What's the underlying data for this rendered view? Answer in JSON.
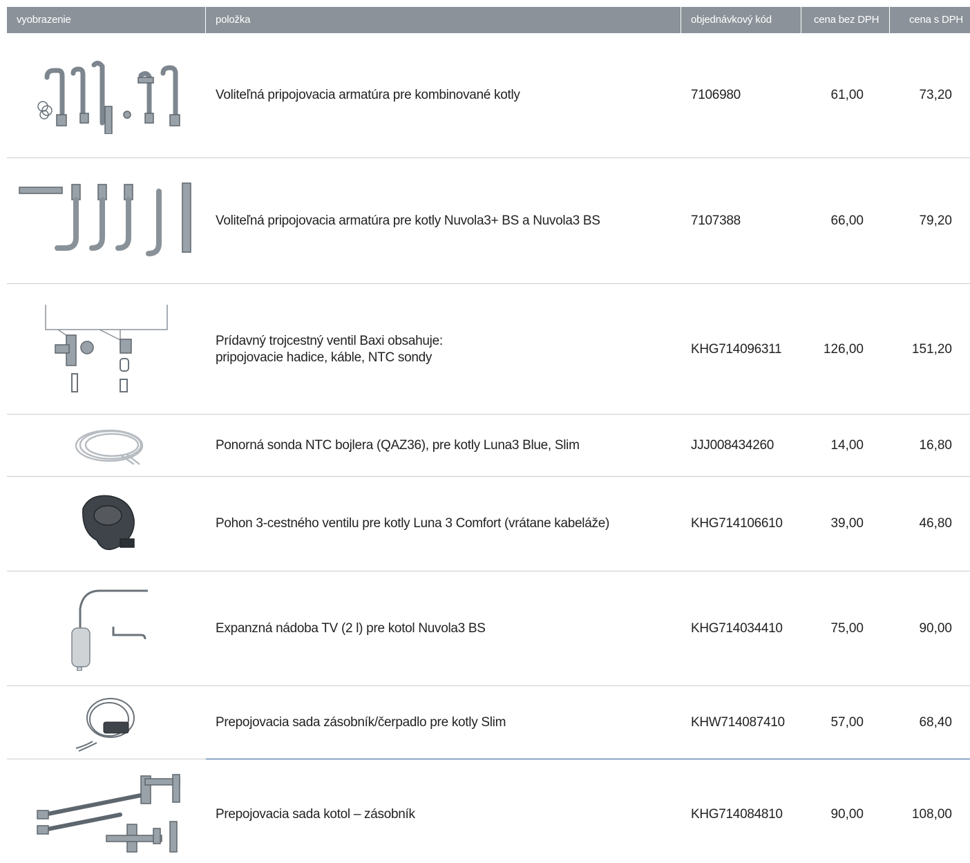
{
  "header": {
    "image": "vyobrazenie",
    "item": "položka",
    "code": "objednávkový kód",
    "price_net": "cena bez DPH",
    "price_gross": "cena s DPH"
  },
  "rows": [
    {
      "item": "Voliteľná pripojovacia armatúra pre kombinované kotly",
      "item2": "",
      "code": "7106980",
      "price_net": "61,00",
      "price_gross": "73,20",
      "icon": "connection-fittings-icon"
    },
    {
      "item": "Voliteľná pripojovacia armatúra pre kotly Nuvola3+ BS a Nuvola3 BS",
      "item2": "",
      "code": "7107388",
      "price_net": "66,00",
      "price_gross": "79,20",
      "icon": "connection-pipes-icon"
    },
    {
      "item": "Prídavný trojcestný ventil Baxi obsahuje:",
      "item2": "pripojovacie hadice, káble, NTC sondy",
      "code": "KHG714096311",
      "price_net": "126,00",
      "price_gross": "151,20",
      "icon": "three-way-valve-icon"
    },
    {
      "item": "Ponorná sonda NTC bojlera (QAZ36), pre kotly Luna3 Blue, Slim",
      "item2": "",
      "code": "JJJ008434260",
      "price_net": "14,00",
      "price_gross": "16,80",
      "icon": "ntc-probe-cable-icon"
    },
    {
      "item": "Pohon 3-cestného ventilu pre kotly Luna 3 Comfort (vrátane kabeláže)",
      "item2": "",
      "code": "KHG714106610",
      "price_net": "39,00",
      "price_gross": "46,80",
      "icon": "valve-actuator-icon"
    },
    {
      "item": "Expanzná nádoba TV (2 l) pre kotol Nuvola3 BS",
      "item2": "",
      "code": "KHG714034410",
      "price_net": "75,00",
      "price_gross": "90,00",
      "icon": "expansion-vessel-icon"
    },
    {
      "item": "Prepojovacia sada zásobník/čerpadlo pre kotly Slim",
      "item2": "",
      "code": "KHW714087410",
      "price_net": "57,00",
      "price_gross": "68,40",
      "icon": "connection-kit-cable-icon"
    },
    {
      "item": "Prepojovacia sada kotol – zásobník",
      "item2": "",
      "code": "KHG714084810",
      "price_net": "90,00",
      "price_gross": "108,00",
      "icon": "flex-hose-kit-icon"
    }
  ],
  "colors": {
    "header_bg": "#8b9299",
    "separator": "#c8ccd0",
    "accent_separator": "#2a5a9a"
  }
}
